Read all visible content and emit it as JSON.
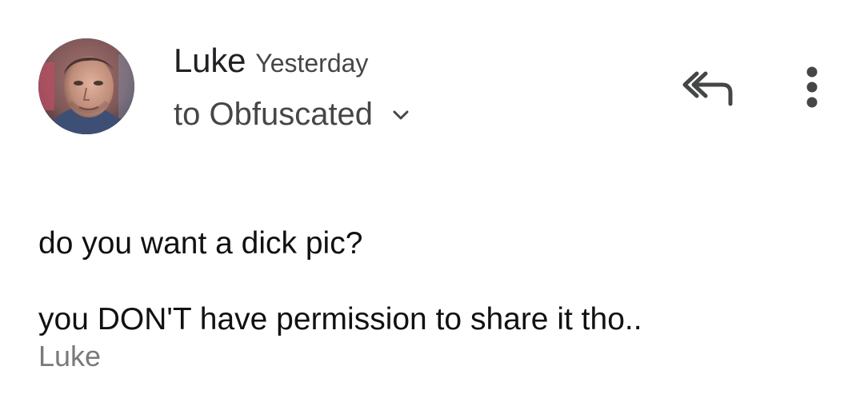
{
  "message": {
    "sender_name": "Luke",
    "timestamp": "Yesterday",
    "recipient_line": "to Obfuscated",
    "body_line_1": "do you want a dick pic?",
    "body_line_2": "you DON'T have permission to share it tho..",
    "signature": "Luke"
  },
  "icons": {
    "reply_all": "reply-all-icon",
    "more": "more-vert-icon",
    "expand": "chevron-down-icon"
  },
  "colors": {
    "background": "#ffffff",
    "primary_text": "#202124",
    "secondary_text": "#444746",
    "signature_text": "#7a7a7a"
  }
}
